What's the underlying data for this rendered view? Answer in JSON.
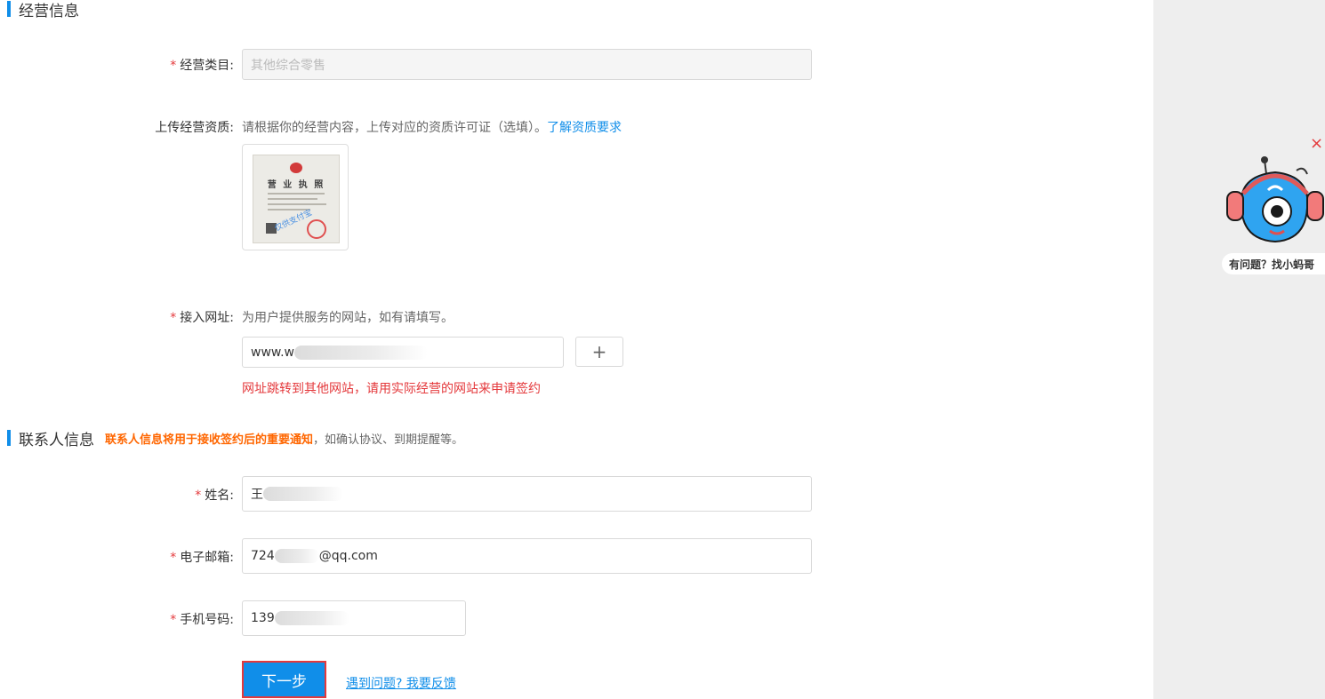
{
  "business_section": {
    "title": "经营信息",
    "category_label": "经营类目:",
    "category_value": "其他综合零售",
    "qualification_label": "上传经营资质:",
    "qualification_hint": "请根据你的经营内容，上传对应的资质许可证（选填）。",
    "qualification_link": "了解资质要求",
    "license_title": "营 业 执 照",
    "license_watermark": "仅供支付宝",
    "website_label": "接入网址:",
    "website_hint": "为用户提供服务的网站，如有请填写。",
    "website_value": "www.w",
    "add_button": "+",
    "website_error": "网址跳转到其他网站，请用实际经营的网站来申请签约"
  },
  "contact_section": {
    "title": "联系人信息",
    "notice_strong": "联系人信息将用于接收签约后的重要通知",
    "notice_rest": "，如确认协议、到期提醒等。",
    "name_label": "姓名:",
    "name_value": "王",
    "email_label": "电子邮箱:",
    "email_prefix": "724",
    "email_suffix": "@qq.com",
    "phone_label": "手机号码:",
    "phone_value": "139"
  },
  "actions": {
    "next_button": "下一步",
    "feedback_link": "遇到问题? 我要反馈"
  },
  "assistant": {
    "close": "×",
    "label": "有问题？找小蚂哥"
  },
  "colors": {
    "accent": "#108ee9",
    "required": "#e4393c",
    "notice": "#ff6600"
  }
}
